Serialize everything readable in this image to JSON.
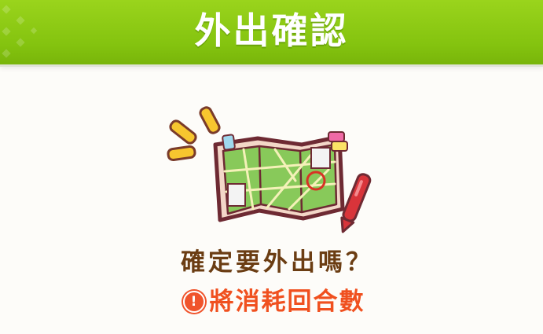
{
  "dialog": {
    "title": "外出確認",
    "illustration_icon": "folded-map-with-pen-icon",
    "question": "確定要外出嗎？",
    "warning": {
      "icon": "exclamation-icon",
      "text": "將消耗回合數",
      "color": "#f0501f"
    }
  },
  "colors": {
    "header_green": "#8bc915",
    "question_brown": "#6b3d13",
    "background": "#fdfcf9"
  }
}
